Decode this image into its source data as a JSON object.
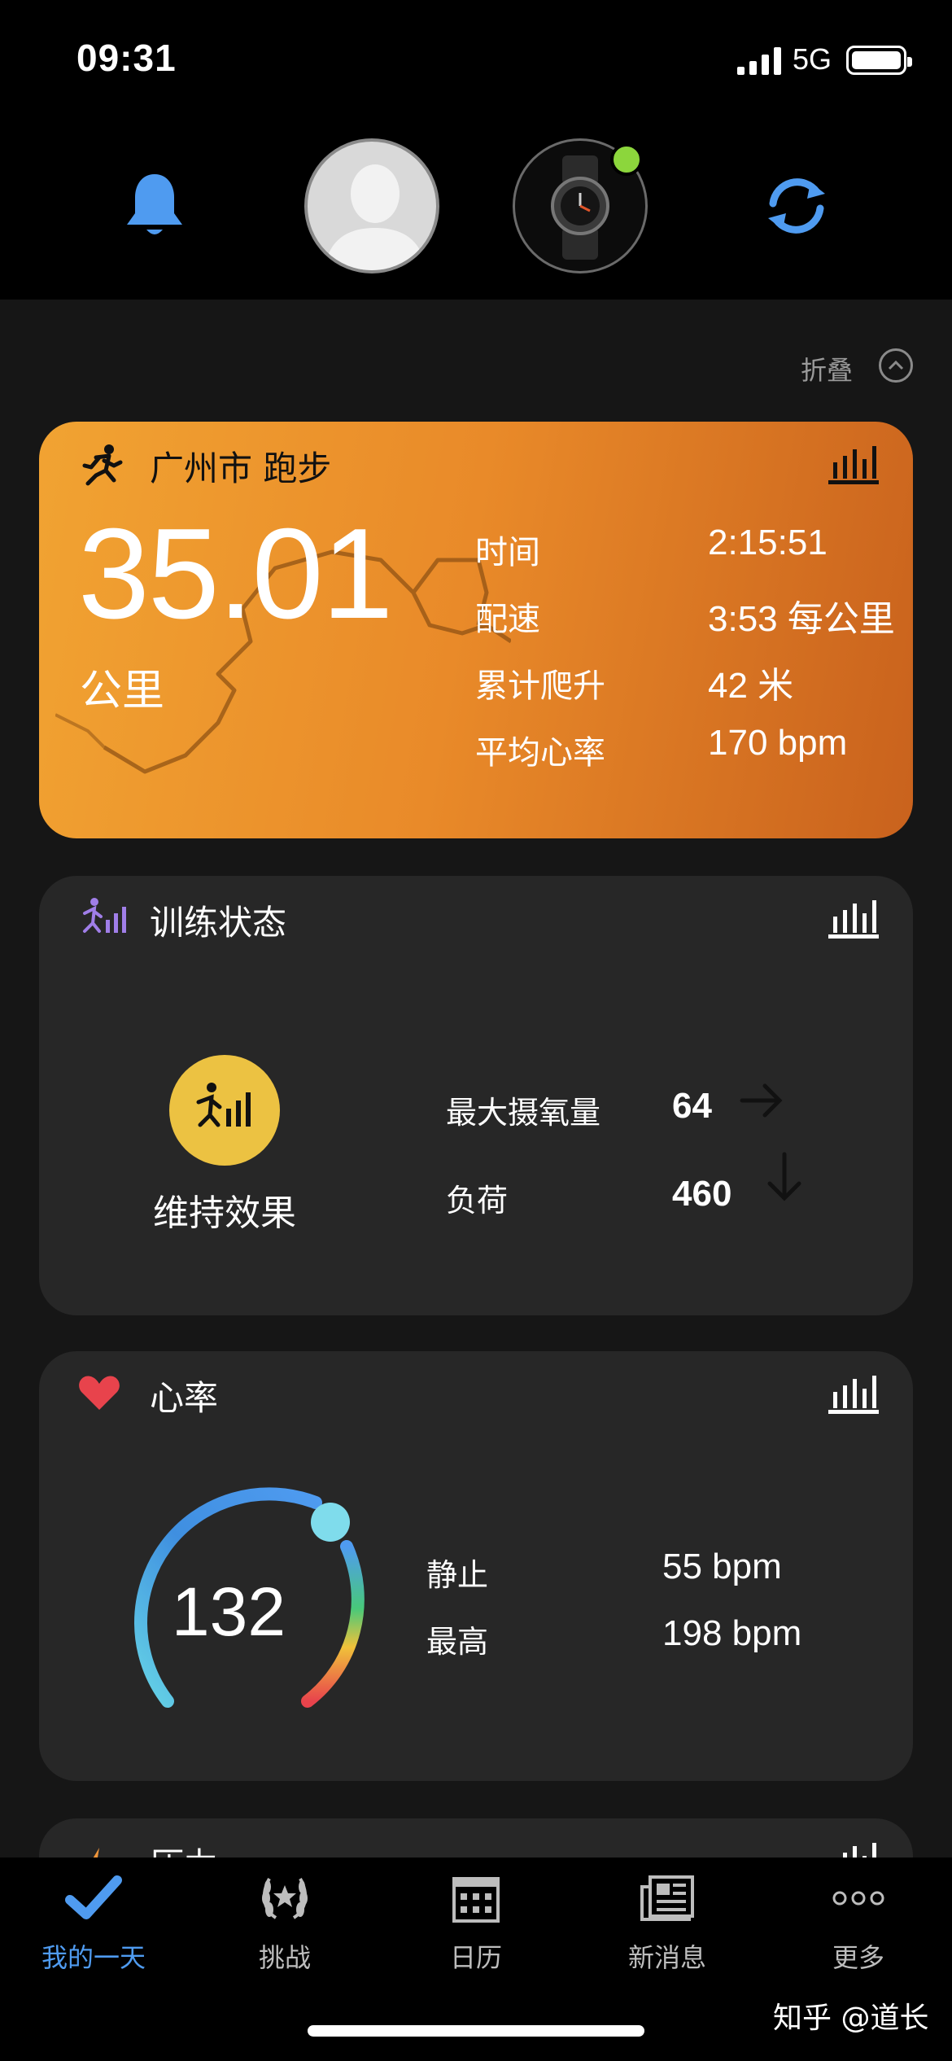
{
  "status_bar": {
    "time": "09:31",
    "network": "5G"
  },
  "header": {
    "fold_label": "折叠"
  },
  "activity": {
    "title": "广州市 跑步",
    "distance": "35.01",
    "unit": "公里",
    "stats": [
      {
        "label": "时间",
        "value": "2:15:51"
      },
      {
        "label": "配速",
        "value": "3:53 每公里"
      },
      {
        "label": "累计爬升",
        "value": "42 米"
      },
      {
        "label": "平均心率",
        "value": "170 bpm"
      }
    ]
  },
  "training": {
    "title": "训练状态",
    "status": "维持效果",
    "metrics": [
      {
        "label": "最大摄氧量",
        "value": "64",
        "trend": "arrow-right"
      },
      {
        "label": "负荷",
        "value": "460",
        "trend": "arrow-down"
      }
    ]
  },
  "heart_rate": {
    "title": "心率",
    "current": "132",
    "rows": [
      {
        "label": "静止",
        "value": "55 bpm"
      },
      {
        "label": "最高",
        "value": "198 bpm"
      }
    ]
  },
  "stress": {
    "title": "压力"
  },
  "tabs": [
    {
      "label": "我的一天",
      "icon": "check-icon",
      "active": true
    },
    {
      "label": "挑战",
      "icon": "laurel-icon",
      "active": false
    },
    {
      "label": "日历",
      "icon": "calendar-icon",
      "active": false
    },
    {
      "label": "新消息",
      "icon": "news-icon",
      "active": false
    },
    {
      "label": "更多",
      "icon": "more-icon",
      "active": false
    }
  ],
  "watermark": "知乎 @道长",
  "colors": {
    "accent": "#4f9bf0",
    "activity_start": "#f1a332",
    "activity_end": "#c9621d",
    "training_status": "#ecc242",
    "heart": "#e8434c",
    "device_online": "#8cd63c"
  }
}
